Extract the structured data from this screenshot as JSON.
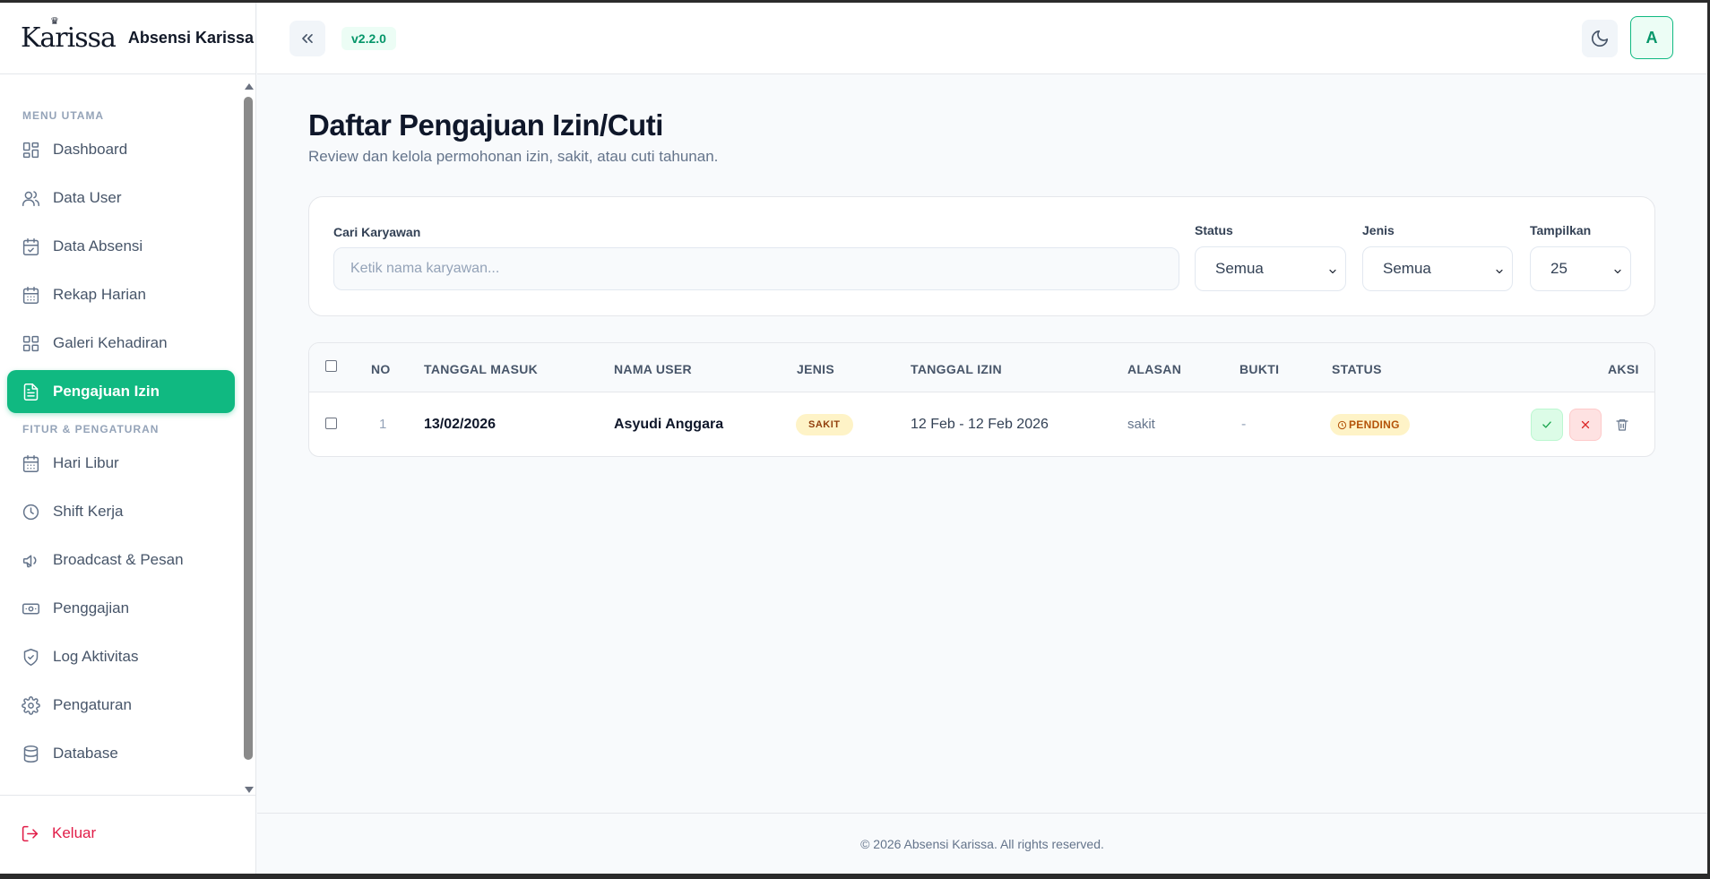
{
  "brand": {
    "logo_text": "Karissa",
    "app_name": "Absensi Karissa"
  },
  "topbar": {
    "version": "v2.2.0",
    "avatar_initial": "A"
  },
  "sidebar": {
    "section_main": "MENU UTAMA",
    "main_items": [
      {
        "label": "Dashboard",
        "icon": "grid-icon"
      },
      {
        "label": "Data User",
        "icon": "users-icon"
      },
      {
        "label": "Data Absensi",
        "icon": "calendar-check-icon"
      },
      {
        "label": "Rekap Harian",
        "icon": "calendar-icon"
      },
      {
        "label": "Galeri Kehadiran",
        "icon": "grid-icon"
      },
      {
        "label": "Pengajuan Izin",
        "icon": "document-icon",
        "active": true
      }
    ],
    "section_features": "FITUR & PENGATURAN",
    "feature_items": [
      {
        "label": "Hari Libur",
        "icon": "calendar-icon"
      },
      {
        "label": "Shift Kerja",
        "icon": "clock-icon"
      },
      {
        "label": "Broadcast & Pesan",
        "icon": "megaphone-icon"
      },
      {
        "label": "Penggajian",
        "icon": "banknote-icon"
      },
      {
        "label": "Log Aktivitas",
        "icon": "shield-check-icon"
      },
      {
        "label": "Pengaturan",
        "icon": "gear-icon"
      },
      {
        "label": "Database",
        "icon": "database-icon"
      }
    ],
    "logout": "Keluar"
  },
  "page": {
    "title": "Daftar Pengajuan Izin/Cuti",
    "subtitle": "Review dan kelola permohonan izin, sakit, atau cuti tahunan."
  },
  "filters": {
    "search_label": "Cari Karyawan",
    "search_placeholder": "Ketik nama karyawan...",
    "search_value": "",
    "status_label": "Status",
    "status_value": "Semua",
    "jenis_label": "Jenis",
    "jenis_value": "Semua",
    "tampilkan_label": "Tampilkan",
    "tampilkan_value": "25"
  },
  "table": {
    "headers": {
      "no": "NO",
      "tanggal_masuk": "TANGGAL MASUK",
      "nama_user": "NAMA USER",
      "jenis": "JENIS",
      "tanggal_izin": "TANGGAL IZIN",
      "alasan": "ALASAN",
      "bukti": "BUKTI",
      "status": "STATUS",
      "aksi": "AKSI"
    },
    "rows": [
      {
        "no": "1",
        "tanggal_masuk": "13/02/2026",
        "nama_user": "Asyudi Anggara",
        "jenis": "SAKIT",
        "tanggal_izin": "12 Feb - 12 Feb 2026",
        "alasan": "sakit",
        "bukti": "-",
        "status": "PENDING"
      }
    ]
  },
  "footer": {
    "text": "© 2026 Absensi Karissa. All rights reserved."
  },
  "colors": {
    "accent": "#10b981",
    "danger": "#e11d48",
    "warning_bg": "#fef3c7"
  }
}
